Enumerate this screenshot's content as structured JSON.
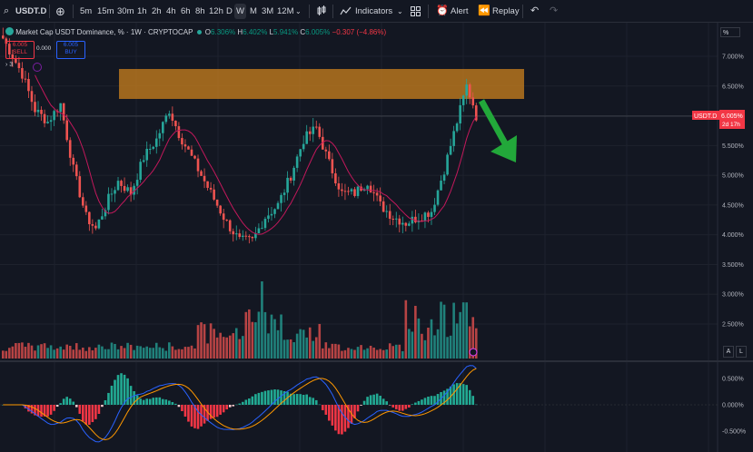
{
  "toolbar": {
    "symbol": "USDT.D",
    "intervals": [
      "5m",
      "15m",
      "30m",
      "1h",
      "2h",
      "4h",
      "6h",
      "8h",
      "12h",
      "D",
      "W",
      "M",
      "3M",
      "12M"
    ],
    "selected_interval": "W",
    "indicators_label": "Indicators",
    "alert_label": "Alert",
    "replay_label": "Replay"
  },
  "legend": {
    "title": "Market Cap USDT Dominance, %",
    "interval": "1W",
    "source": "CRYPTOCAP",
    "open_label": "O",
    "open_value": "6.306%",
    "high_label": "H",
    "high_value": "6.402%",
    "low_label": "L",
    "low_value": "5.941%",
    "close_label": "C",
    "close_value": "6.005%",
    "change": "−0.307 (−4.86%)",
    "indicator_count": "3"
  },
  "trade": {
    "sell_price": "6.005",
    "sell_label": "SELL",
    "spread": "0.000",
    "buy_price": "6.005",
    "buy_label": "BUY"
  },
  "price_scale": {
    "unit": "%",
    "labels": [
      "7.000%",
      "6.500%",
      "6.000%",
      "5.500%",
      "5.000%",
      "4.500%",
      "4.000%",
      "3.500%",
      "3.000%",
      "2.500%"
    ],
    "last_symbol": "USDT.D",
    "last_value": "6.005%",
    "countdown": "2d 17h"
  },
  "osc_scale": {
    "labels": [
      "0.500%",
      "0.000%",
      "-0.500%"
    ]
  },
  "scale_buttons": {
    "auto": "A",
    "log": "L"
  },
  "colors": {
    "up": "#26a69a",
    "down": "#ef5350",
    "ma": "#c2185b",
    "zone": "#c07a1e",
    "arrow": "#22a83a",
    "background": "#131722"
  }
}
